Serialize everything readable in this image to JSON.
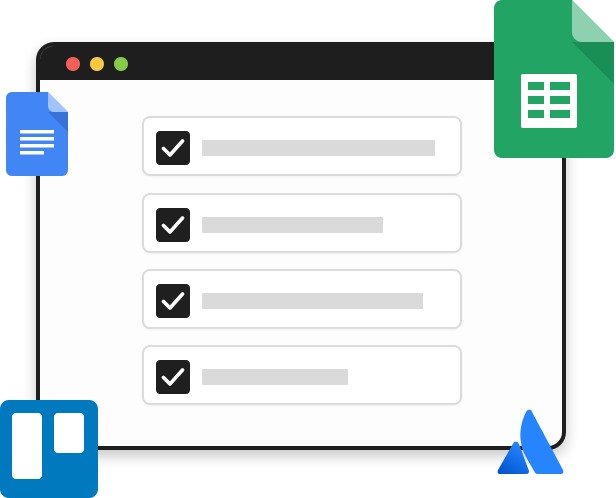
{
  "window": {
    "controls": [
      {
        "name": "close",
        "color": "#f25f57"
      },
      {
        "name": "minimize",
        "color": "#f8c840"
      },
      {
        "name": "maximize",
        "color": "#84cb47"
      }
    ]
  },
  "checklist": {
    "items": [
      {
        "checked": true,
        "text_length_fraction": 0.94
      },
      {
        "checked": true,
        "text_length_fraction": 0.73
      },
      {
        "checked": true,
        "text_length_fraction": 0.89
      },
      {
        "checked": true,
        "text_length_fraction": 0.59
      }
    ]
  },
  "icons": [
    {
      "name": "google-docs-icon",
      "color": "#4285f4"
    },
    {
      "name": "google-sheets-icon",
      "color": "#21a464"
    },
    {
      "name": "trello-icon",
      "color": "#0079bf"
    },
    {
      "name": "atlassian-icon",
      "color": "#2684ff"
    }
  ],
  "colors": {
    "window_frame": "#1e1e1e",
    "checkbox": "#1f1f1f",
    "placeholder": "#dadada",
    "item_border": "#dcdcdc"
  }
}
